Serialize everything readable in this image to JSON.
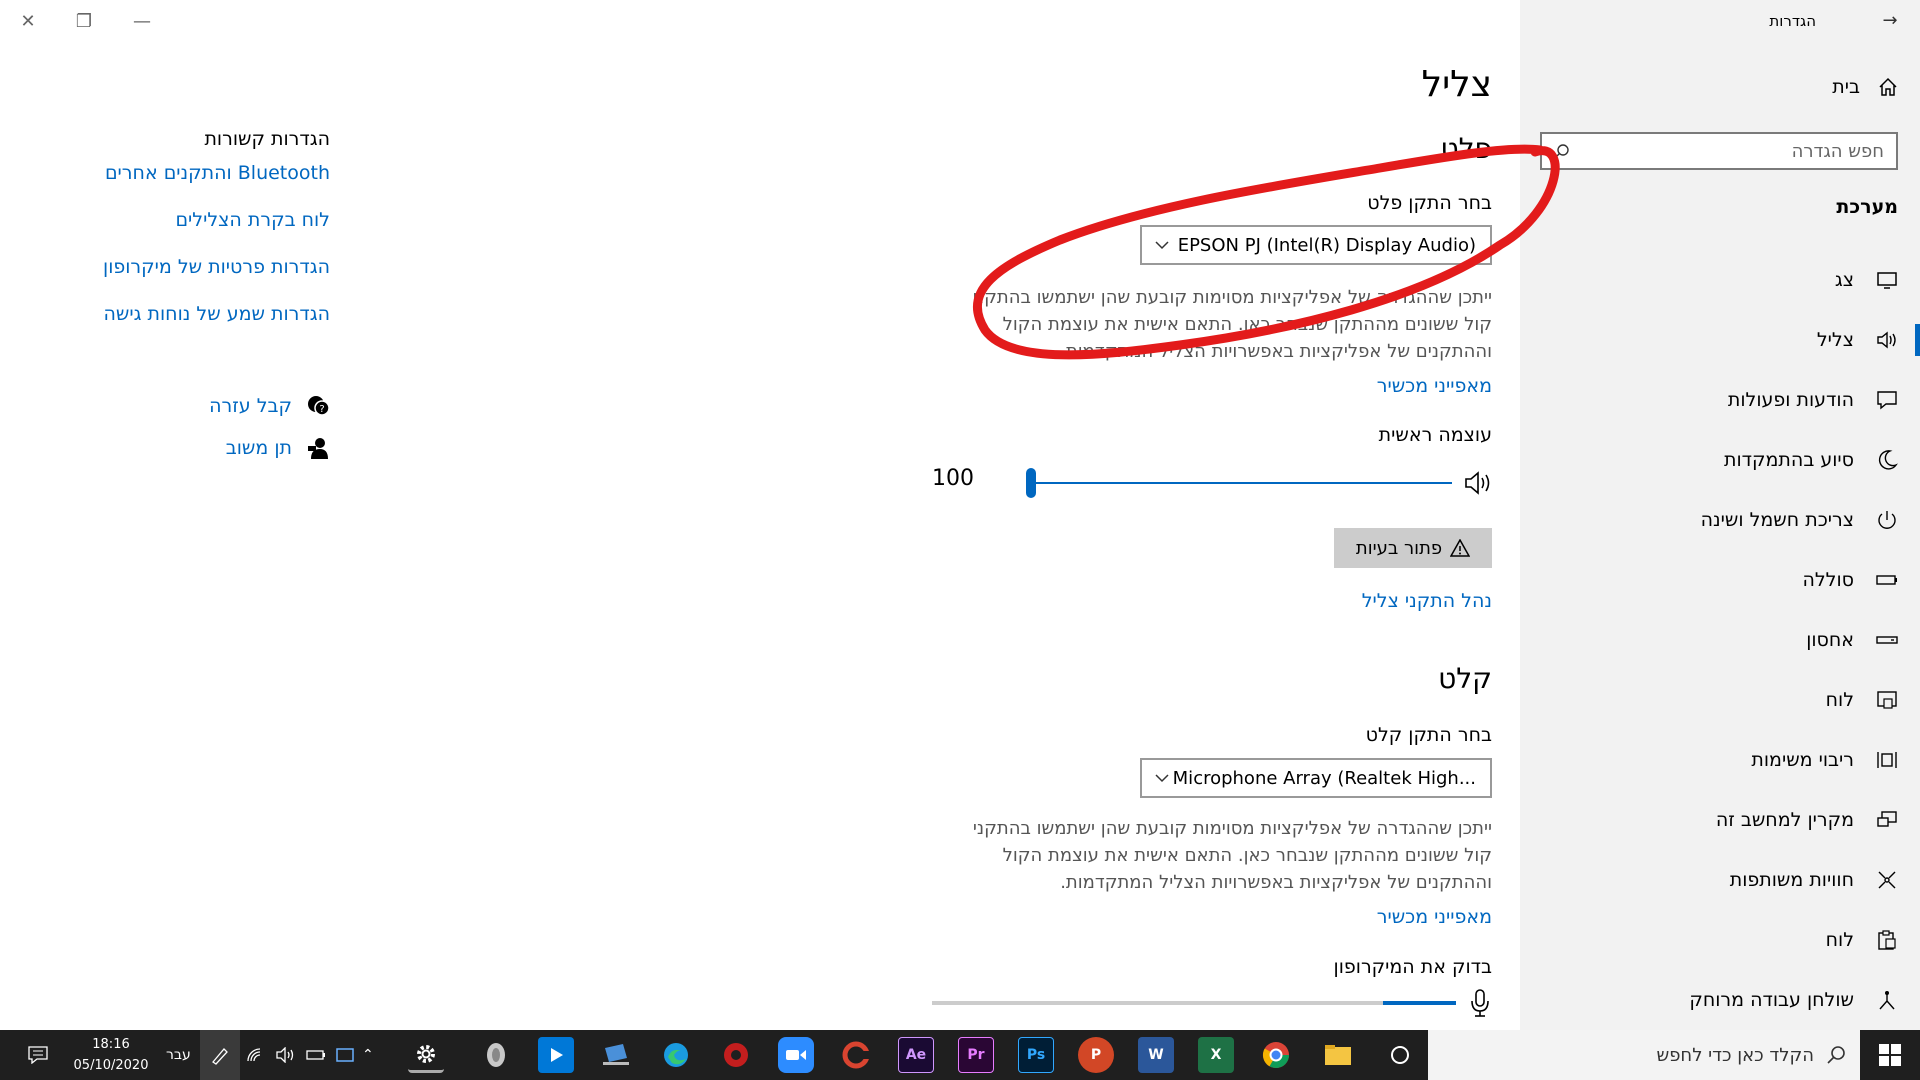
{
  "window": {
    "title": "הגדרות"
  },
  "sidebar": {
    "home_label": "בית",
    "search_placeholder": "חפש הגדרה",
    "category": "מערכת",
    "items": [
      {
        "label": "צג",
        "icon": "monitor-icon"
      },
      {
        "label": "צליל",
        "icon": "speaker-icon",
        "active": true
      },
      {
        "label": "הודעות ופעולות",
        "icon": "notification-icon"
      },
      {
        "label": "סיוע בהתמקדות",
        "icon": "moon-icon"
      },
      {
        "label": "צריכת חשמל ושינה",
        "icon": "power-icon"
      },
      {
        "label": "סוללה",
        "icon": "battery-icon"
      },
      {
        "label": "אחסון",
        "icon": "storage-icon"
      },
      {
        "label": "לוח",
        "icon": "tablet-icon"
      },
      {
        "label": "ריבוי משימות",
        "icon": "multitasking-icon"
      },
      {
        "label": "מקרין למחשב זה",
        "icon": "projecting-icon"
      },
      {
        "label": "חוויות משותפות",
        "icon": "shared-icon"
      },
      {
        "label": "לוח",
        "icon": "clipboard-icon"
      },
      {
        "label": "שולחן עבודה מרוחק",
        "icon": "remote-desktop-icon"
      }
    ]
  },
  "main": {
    "title": "צליל",
    "output": {
      "heading": "פלט",
      "choose_label": "בחר התקן פלט",
      "device": "EPSON PJ (Intel(R) Display Audio)",
      "desc_lines": [
        "ייתכן שההגדרה של אפליקציות מסוימות קובעת שהן ישתמשו בהתקני",
        "קול ששונים מההתקן שנבחר כאן. התאם אישית את עוצמת הקול",
        "וההתקנים של אפליקציות באפשרויות הצליל המתקדמות."
      ],
      "properties_link": "מאפייני מכשיר",
      "master_volume_label": "עוצמה ראשית",
      "volume_value": "100",
      "volume_fraction": 1.0,
      "troubleshoot_label": "פתור בעיות",
      "manage_link": "נהל התקני צליל"
    },
    "input": {
      "heading": "קלט",
      "choose_label": "בחר התקן קלט",
      "device": "Microphone Array (Realtek High...",
      "desc_lines": [
        "ייתכן שההגדרה של אפליקציות מסוימות קובעת שהן ישתמשו בהתקני",
        "קול ששונים מההתקן שנבחר כאן. התאם אישית את עוצמת הקול",
        "וההתקנים של אפליקציות באפשרויות הצליל המתקדמות."
      ],
      "properties_link": "מאפייני מכשיר",
      "test_mic_label": "בדוק את המיקרופון",
      "mic_level_fraction": 0.14
    }
  },
  "related": {
    "heading": "הגדרות קשורות",
    "links": [
      "Bluetooth והתקנים אחרים",
      "לוח בקרת הצלילים",
      "הגדרות פרטיות של מיקרופון",
      "הגדרות שמע של נוחות גישה"
    ],
    "help_label": "קבל עזרה",
    "feedback_label": "תן משוב"
  },
  "taskbar": {
    "search_placeholder": "הקלד כאן כדי לחפש",
    "time": "18:16",
    "date": "05/10/2020",
    "language": "עבר",
    "apps": [
      "cortana",
      "file-explorer",
      "chrome",
      "excel",
      "word",
      "powerpoint",
      "photoshop",
      "premiere",
      "after-effects",
      "ccleaner",
      "zoom",
      "screen-recorder",
      "edge",
      "pc-settings",
      "media-player",
      "unknown-app",
      "settings"
    ]
  },
  "colors": {
    "accent": "#0067c0",
    "annotation": "#e31b1b",
    "sidebar_bg": "#f2f2f2",
    "taskbar_bg": "#1f1f1f"
  }
}
